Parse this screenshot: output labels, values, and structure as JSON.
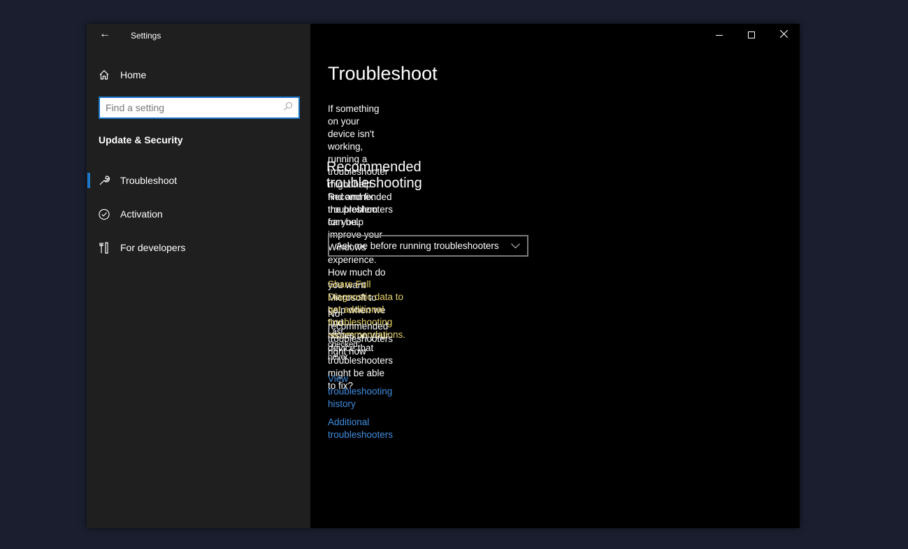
{
  "app": {
    "title": "Settings"
  },
  "sidebar": {
    "home": "Home",
    "search_placeholder": "Find a setting",
    "section": "Update & Security",
    "items": [
      {
        "label": "Troubleshoot"
      },
      {
        "label": "Activation"
      },
      {
        "label": "For developers"
      }
    ]
  },
  "main": {
    "title": "Troubleshoot",
    "intro": [
      "If something on your device isn't working, running a troubleshooter",
      "might help find and fix the problem for you."
    ],
    "rec_heading": "Recommended troubleshooting",
    "rec_desc": [
      "Recommended troubleshooters can help improve your Windows",
      "experience. How much do you want Microsoft to help when we find",
      "issues on your device that troubleshooters might be able to fix?"
    ],
    "dropdown_value": "Ask me before running troubleshooters",
    "diag_notice": [
      "Share Full Diagnostic data to get additional troubleshooting",
      "recommendations."
    ],
    "status": "No recommended troubleshooters right now",
    "last_checked": "Last checked: never",
    "history_link": "View troubleshooting history",
    "additional_link": "Additional troubleshooters"
  },
  "colors": {
    "accent": "#1b76c8",
    "link": "#3f8ee0",
    "warning": "#e8d36a"
  }
}
